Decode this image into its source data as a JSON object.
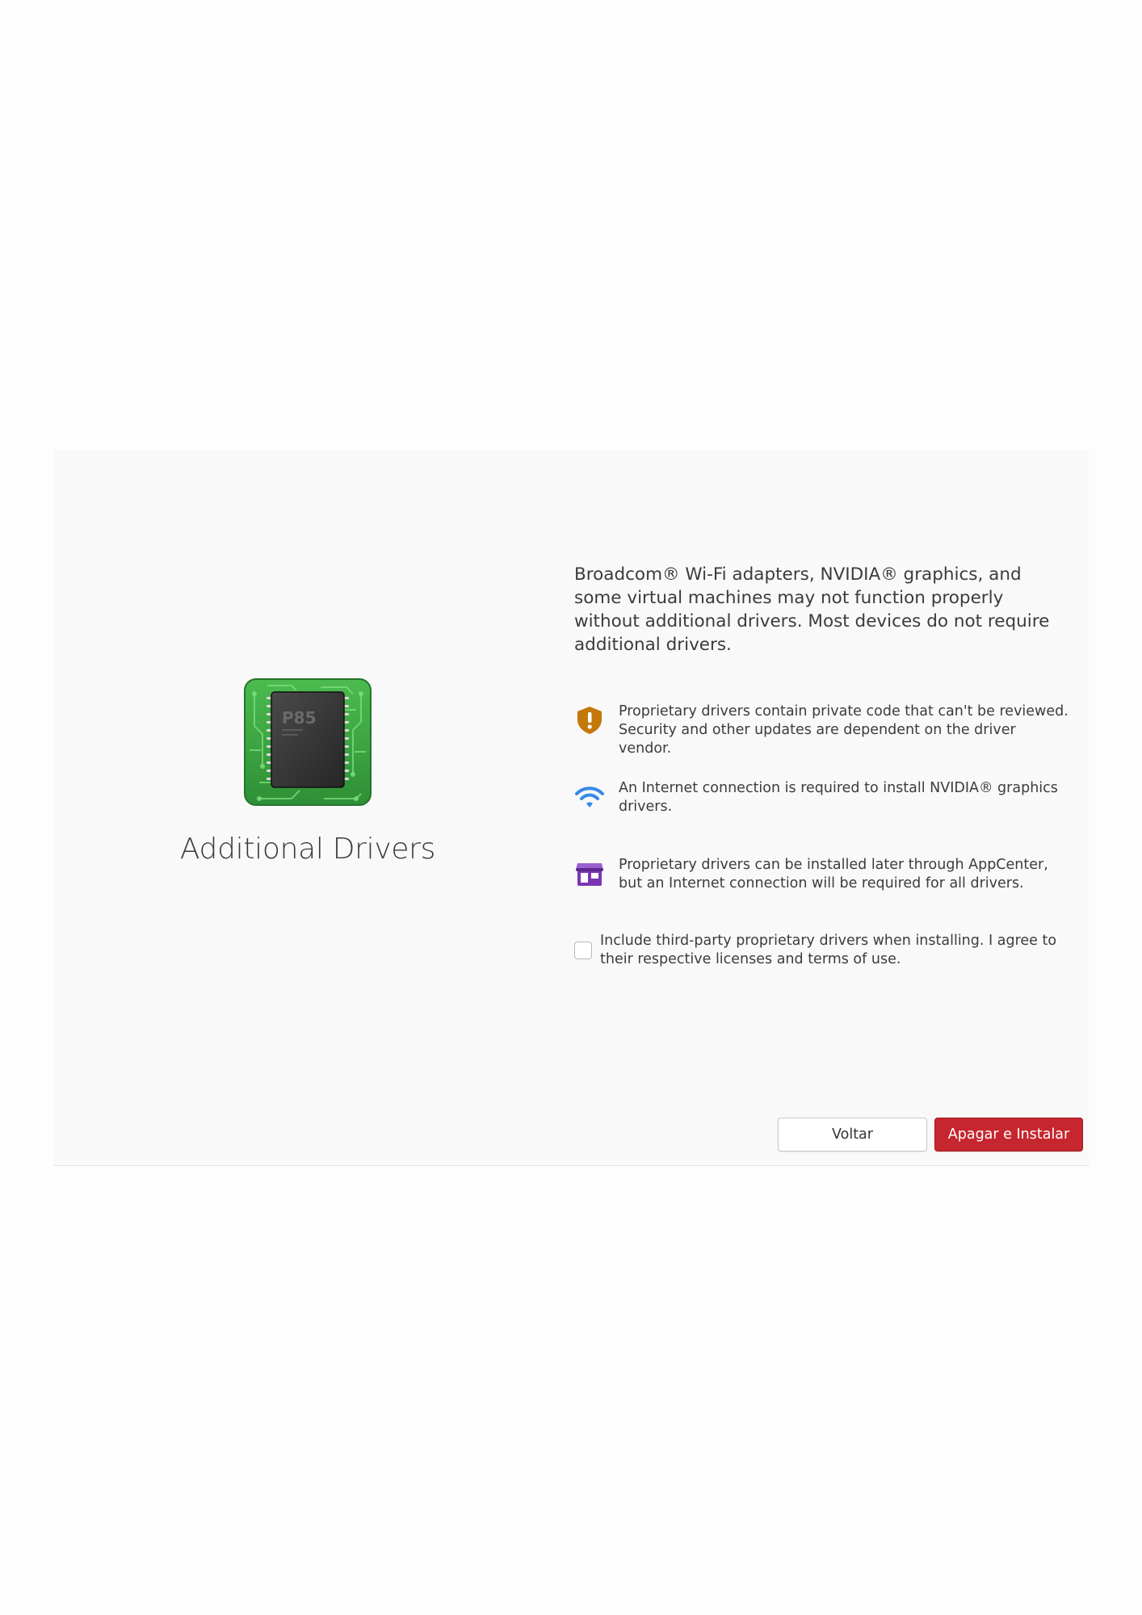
{
  "app": {
    "title": "Additional Drivers",
    "icon": "memory-chip-icon",
    "chip_label": "P85"
  },
  "intro": {
    "text": "Broadcom® Wi-Fi adapters, NVIDIA® graphics, and some virtual machines may not function properly without additional drivers. Most devices do not require additional drivers."
  },
  "notes": [
    {
      "icon": "shield-warning-icon",
      "text": "Proprietary drivers contain private code that can't be reviewed. Security and other updates are dependent on the driver vendor."
    },
    {
      "icon": "wifi-icon",
      "text": "An Internet connection is required to install NVIDIA® graphics drivers."
    },
    {
      "icon": "appcenter-icon",
      "text": "Proprietary drivers can be installed later through AppCenter, but an Internet connection will be required for all drivers."
    }
  ],
  "consent": {
    "checked": false,
    "label": "Include third-party proprietary drivers when installing. I agree to their respective licenses and terms of use."
  },
  "buttons": {
    "back_label": "Voltar",
    "install_label": "Apagar e Instalar"
  },
  "colors": {
    "shield": "#c4780a",
    "wifi": "#3689e6",
    "appcenter": "#7a36b1",
    "destructive": "#c6262e",
    "chip_board": "#3aa844"
  }
}
